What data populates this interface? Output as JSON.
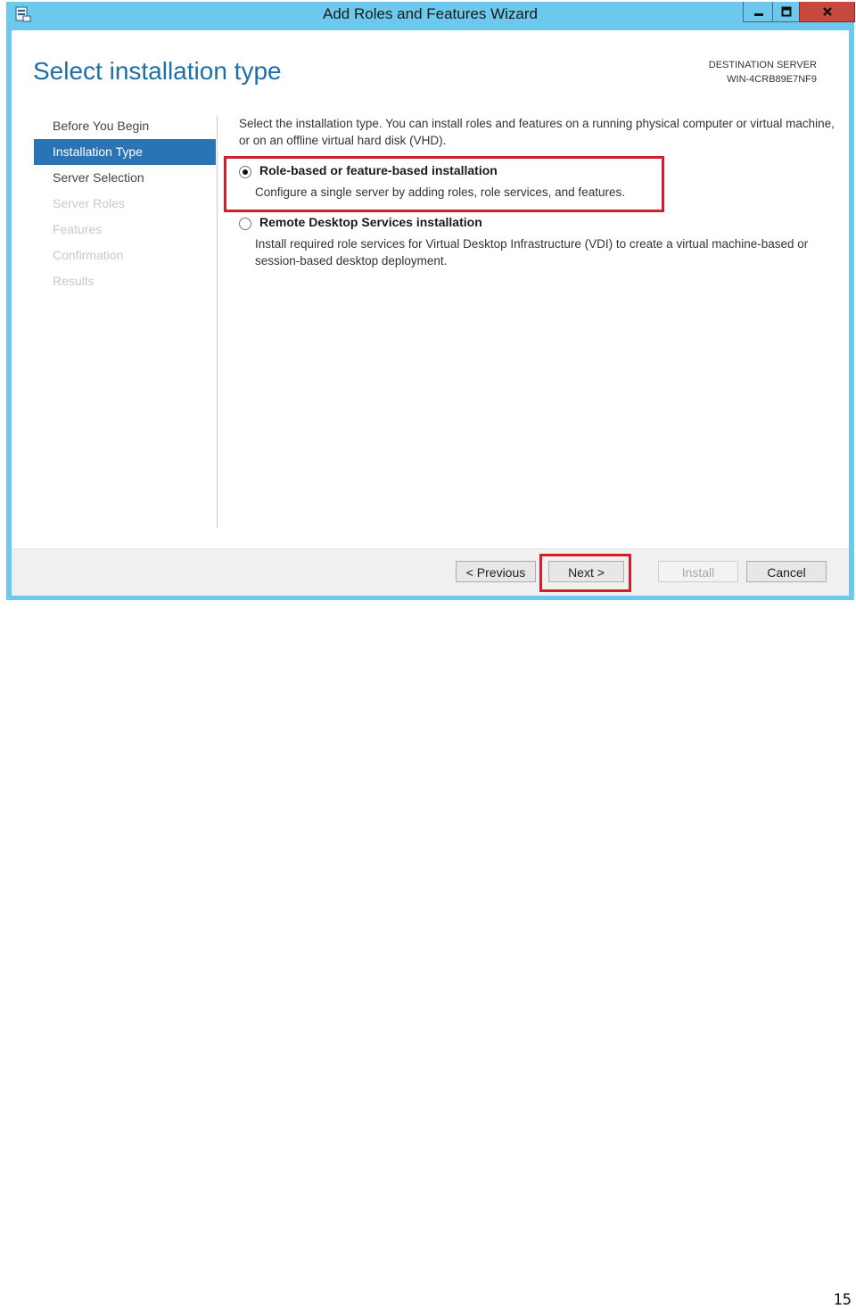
{
  "window": {
    "title": "Add Roles and Features Wizard",
    "controls": {
      "minimize": "–",
      "maximize": "□",
      "close": "✕"
    },
    "app_icon": "server-manager-icon"
  },
  "page": {
    "title": "Select installation type",
    "destination_label": "DESTINATION SERVER",
    "destination_server": "WIN-4CRB89E7NF9"
  },
  "nav": {
    "items": [
      {
        "label": "Before You Begin",
        "state": "normal"
      },
      {
        "label": "Installation Type",
        "state": "active"
      },
      {
        "label": "Server Selection",
        "state": "normal"
      },
      {
        "label": "Server Roles",
        "state": "disabled"
      },
      {
        "label": "Features",
        "state": "disabled"
      },
      {
        "label": "Confirmation",
        "state": "disabled"
      },
      {
        "label": "Results",
        "state": "disabled"
      }
    ]
  },
  "content": {
    "intro": "Select the installation type. You can install roles and features on a running physical computer or virtual machine, or on an offline virtual hard disk (VHD).",
    "options": [
      {
        "title": "Role-based or feature-based installation",
        "description": "Configure a single server by adding roles, role services, and features.",
        "selected": true
      },
      {
        "title": "Remote Desktop Services installation",
        "description": "Install required role services for Virtual Desktop Infrastructure (VDI) to create a virtual machine-based or session-based desktop deployment.",
        "selected": false
      }
    ]
  },
  "footer": {
    "previous": "< Previous",
    "next": "Next >",
    "install": "Install",
    "cancel": "Cancel"
  },
  "colors": {
    "accent": "#2a74b6",
    "frame": "#6cc8ec",
    "highlight": "#d0202e"
  },
  "page_number": "15"
}
